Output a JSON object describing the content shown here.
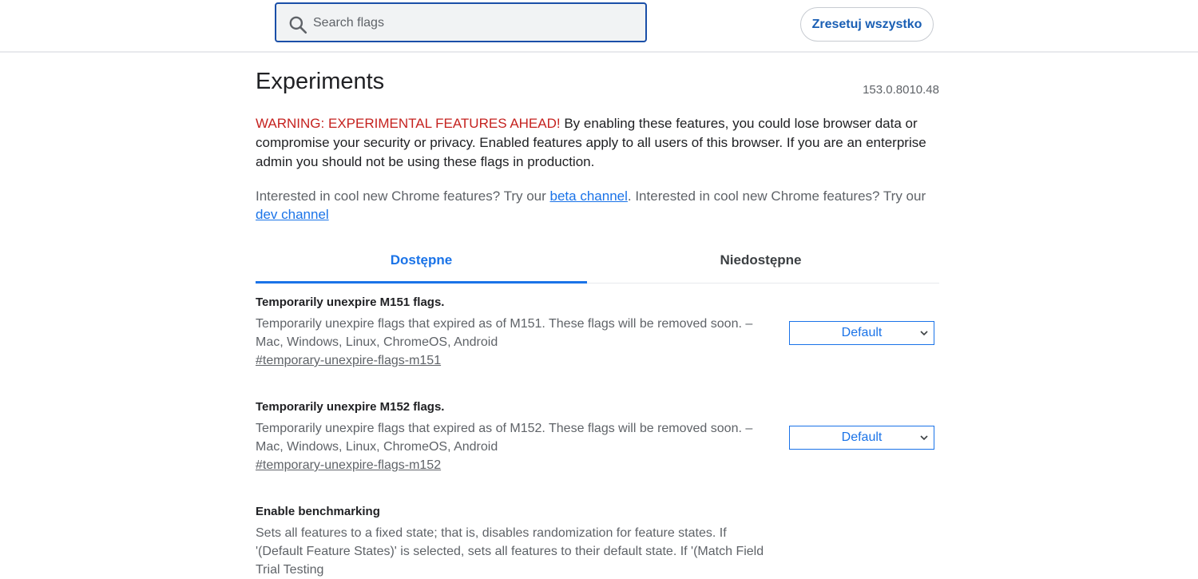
{
  "header": {
    "search_placeholder": "Search flags",
    "reset_label": "Zresetuj wszystko"
  },
  "page": {
    "title": "Experiments",
    "version": "153.0.8010.48",
    "warning_red": "WARNING: EXPERIMENTAL FEATURES AHEAD!",
    "warning_text": " By enabling these features, you could lose browser data or compromise your security or privacy. Enabled features apply to all users of this browser. If you are an enterprise admin you should not be using these flags in production.",
    "channel_text_1": "Interested in cool new Chrome features? Try our ",
    "beta_link": "beta channel",
    "channel_text_2": ". Interested in cool new Chrome features? Try our ",
    "dev_link": "dev channel"
  },
  "tabs": [
    {
      "label": "Dostępne",
      "active": true
    },
    {
      "label": "Niedostępne",
      "active": false
    }
  ],
  "flags": [
    {
      "title": "Temporarily unexpire M151 flags.",
      "description": "Temporarily unexpire flags that expired as of M151. These flags will be removed soon. – Mac, Windows, Linux, ChromeOS, Android",
      "anchor": "#temporary-unexpire-flags-m151",
      "value": "Default"
    },
    {
      "title": "Temporarily unexpire M152 flags.",
      "description": "Temporarily unexpire flags that expired as of M152. These flags will be removed soon. – Mac, Windows, Linux, ChromeOS, Android",
      "anchor": "#temporary-unexpire-flags-m152",
      "value": "Default"
    },
    {
      "title": "Enable benchmarking",
      "description": "Sets all features to a fixed state; that is, disables randomization for feature states. If '(Default Feature States)' is selected, sets all features to their default state. If '(Match Field Trial Testing"
    }
  ],
  "icons": {
    "search": "search-icon",
    "dropdown": "chevron-down-icon"
  },
  "colors": {
    "accent": "#1a73e8",
    "warning": "#c5221f",
    "search_border": "#1a4fa8"
  }
}
